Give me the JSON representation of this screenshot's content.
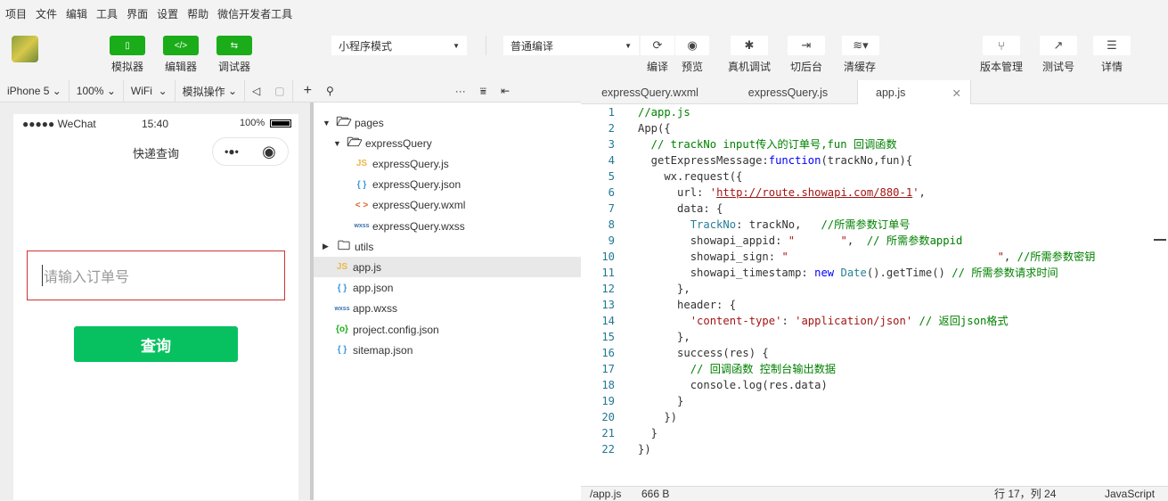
{
  "menu": [
    "项目",
    "文件",
    "编辑",
    "工具",
    "界面",
    "设置",
    "帮助",
    "微信开发者工具"
  ],
  "toolbar": {
    "simulator": "模拟器",
    "editor": "编辑器",
    "debugger": "调试器",
    "mode": "小程序模式",
    "compile_mode": "普通编译",
    "compile": "编译",
    "preview": "预览",
    "remote_debug": "真机调试",
    "background": "切后台",
    "clear_cache": "清缓存",
    "version": "版本管理",
    "test_account": "测试号",
    "details": "详情",
    "accent": "#1aad19"
  },
  "subbar": {
    "device": "iPhone 5",
    "zoom": "100%",
    "network": "WiFi",
    "sim_ops": "模拟操作"
  },
  "phone": {
    "carrier": "●●●●● WeChat",
    "time": "15:40",
    "battery": "100%",
    "title": "快递查询",
    "input_placeholder": "请输入订单号",
    "button": "查询",
    "button_color": "#07c160"
  },
  "tree": [
    {
      "name": "pages",
      "type": "folder-open",
      "depth": 0,
      "arrow": "▼"
    },
    {
      "name": "expressQuery",
      "type": "folder-open",
      "depth": 1,
      "arrow": "▼"
    },
    {
      "name": "expressQuery.js",
      "type": "js",
      "depth": 2
    },
    {
      "name": "expressQuery.json",
      "type": "json",
      "depth": 2
    },
    {
      "name": "expressQuery.wxml",
      "type": "wxml",
      "depth": 2
    },
    {
      "name": "expressQuery.wxss",
      "type": "wxss",
      "depth": 2
    },
    {
      "name": "utils",
      "type": "folder",
      "depth": 0,
      "arrow": "▶"
    },
    {
      "name": "app.js",
      "type": "js",
      "depth": 1,
      "selected": true
    },
    {
      "name": "app.json",
      "type": "json",
      "depth": 1
    },
    {
      "name": "app.wxss",
      "type": "wxss",
      "depth": 1
    },
    {
      "name": "project.config.json",
      "type": "config",
      "depth": 1
    },
    {
      "name": "sitemap.json",
      "type": "json",
      "depth": 1
    }
  ],
  "tabs": [
    "expressQuery.wxml",
    "expressQuery.js",
    "app.js"
  ],
  "code": [
    [
      [
        "//app.js",
        "c"
      ]
    ],
    [
      [
        "App({",
        ""
      ]
    ],
    [
      [
        "  // trackNo input传入的订单号,fun 回调函数",
        "c"
      ]
    ],
    [
      [
        "  getExpressMessage:",
        ""
      ],
      [
        "function",
        "k"
      ],
      [
        "(trackNo,fun){",
        ""
      ]
    ],
    [
      [
        "    wx.request({",
        ""
      ]
    ],
    [
      [
        "      url: ",
        ""
      ],
      [
        "'",
        "s"
      ],
      [
        "http://route.showapi.com/880-1",
        "u"
      ],
      [
        "'",
        "s"
      ],
      [
        ",",
        ""
      ]
    ],
    [
      [
        "      data: {",
        ""
      ]
    ],
    [
      [
        "        ",
        ""
      ],
      [
        "TrackNo",
        "p"
      ],
      [
        ": trackNo,   ",
        ""
      ],
      [
        "//所需参数订单号",
        "c"
      ]
    ],
    [
      [
        "        showapi_appid: ",
        ""
      ],
      [
        "\"       \"",
        "s"
      ],
      [
        ",  ",
        ""
      ],
      [
        "// 所需参数appid",
        "c"
      ]
    ],
    [
      [
        "        showapi_sign: ",
        ""
      ],
      [
        "\"                                \"",
        "s"
      ],
      [
        ", ",
        ""
      ],
      [
        "//所需参数密钥",
        "c"
      ]
    ],
    [
      [
        "        showapi_timestamp: ",
        ""
      ],
      [
        "new",
        "k"
      ],
      [
        " ",
        ""
      ],
      [
        "Date",
        "p"
      ],
      [
        "().getTime() ",
        ""
      ],
      [
        "// 所需参数请求时间",
        "c"
      ]
    ],
    [
      [
        "      },",
        ""
      ]
    ],
    [
      [
        "      header: {",
        ""
      ]
    ],
    [
      [
        "        ",
        ""
      ],
      [
        "'content-type'",
        "s"
      ],
      [
        ": ",
        ""
      ],
      [
        "'application/json'",
        "s"
      ],
      [
        " ",
        ""
      ],
      [
        "// 返回json格式",
        "c"
      ]
    ],
    [
      [
        "      },",
        ""
      ]
    ],
    [
      [
        "      success(res) {",
        ""
      ]
    ],
    [
      [
        "        // 回调函数 控制台输出数据",
        "c"
      ]
    ],
    [
      [
        "        console.log(res.data)",
        ""
      ]
    ],
    [
      [
        "      }",
        ""
      ]
    ],
    [
      [
        "    })",
        ""
      ]
    ],
    [
      [
        "  }",
        ""
      ]
    ],
    [
      [
        "})",
        ""
      ]
    ]
  ],
  "statusbar": {
    "path": "/app.js",
    "size": "666 B",
    "position": "行 17，列 24",
    "language": "JavaScript"
  }
}
